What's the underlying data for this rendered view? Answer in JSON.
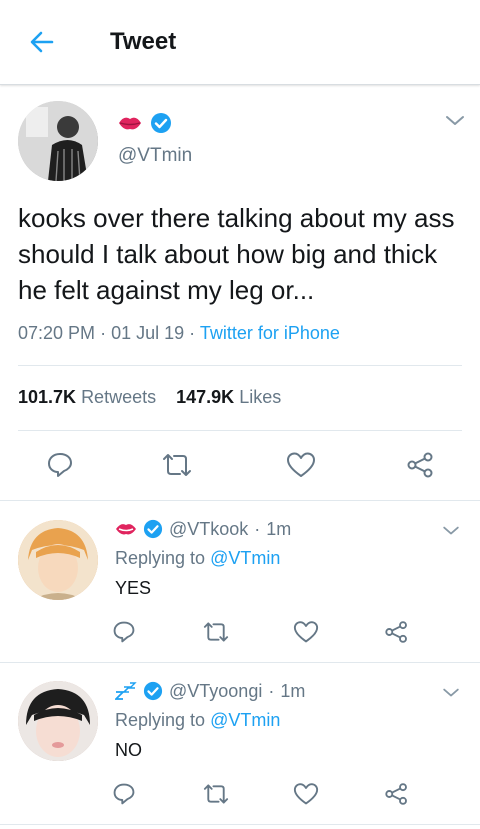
{
  "header": {
    "title": "Tweet"
  },
  "main_tweet": {
    "handle": "@VTmin",
    "text": "kooks over there talking about my ass should I talk about how big and thick he felt against my leg or...",
    "time": "07:20 PM",
    "date": "01 Jul 19",
    "source": "Twitter for iPhone",
    "retweets_count": "101.7K",
    "retweets_label": "Retweets",
    "likes_count": "147.9K",
    "likes_label": "Likes",
    "emoji": "lips-emoji"
  },
  "replies": [
    {
      "handle": "@VTkook",
      "time": "1m",
      "replying_label": "Replying to",
      "replying_to": "@VTmin",
      "text": "YES",
      "emoji": "mouth-emoji"
    },
    {
      "handle": "@VTyoongi",
      "time": "1m",
      "replying_label": "Replying to",
      "replying_to": "@VTmin",
      "text": "NO",
      "emoji": "zzz-emoji"
    }
  ],
  "colors": {
    "accent": "#1da1f2",
    "text": "#14171a",
    "secondary": "#657786",
    "divider": "#e1e8ed",
    "icon": "#657786"
  }
}
